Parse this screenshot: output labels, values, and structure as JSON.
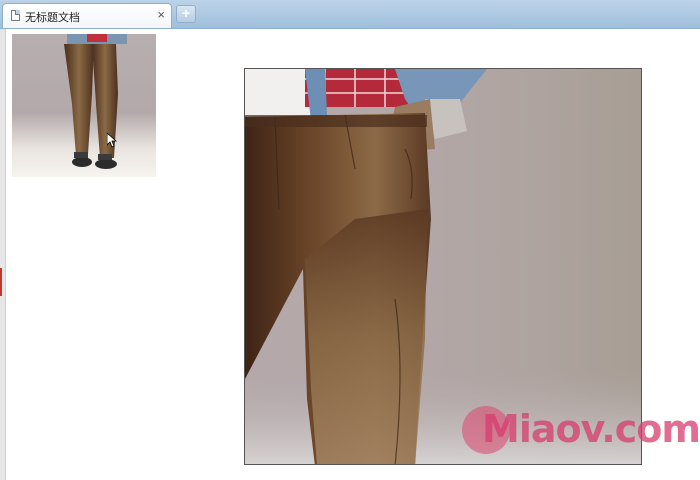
{
  "tab": {
    "title": "无标题文档",
    "close_label": "×"
  },
  "new_tab_label": "+",
  "watermark": {
    "text": "Miaov.com",
    "color": "#d73c6e"
  },
  "colors": {
    "tabbar": "#9fbfdc",
    "accent": "#c0392b"
  }
}
